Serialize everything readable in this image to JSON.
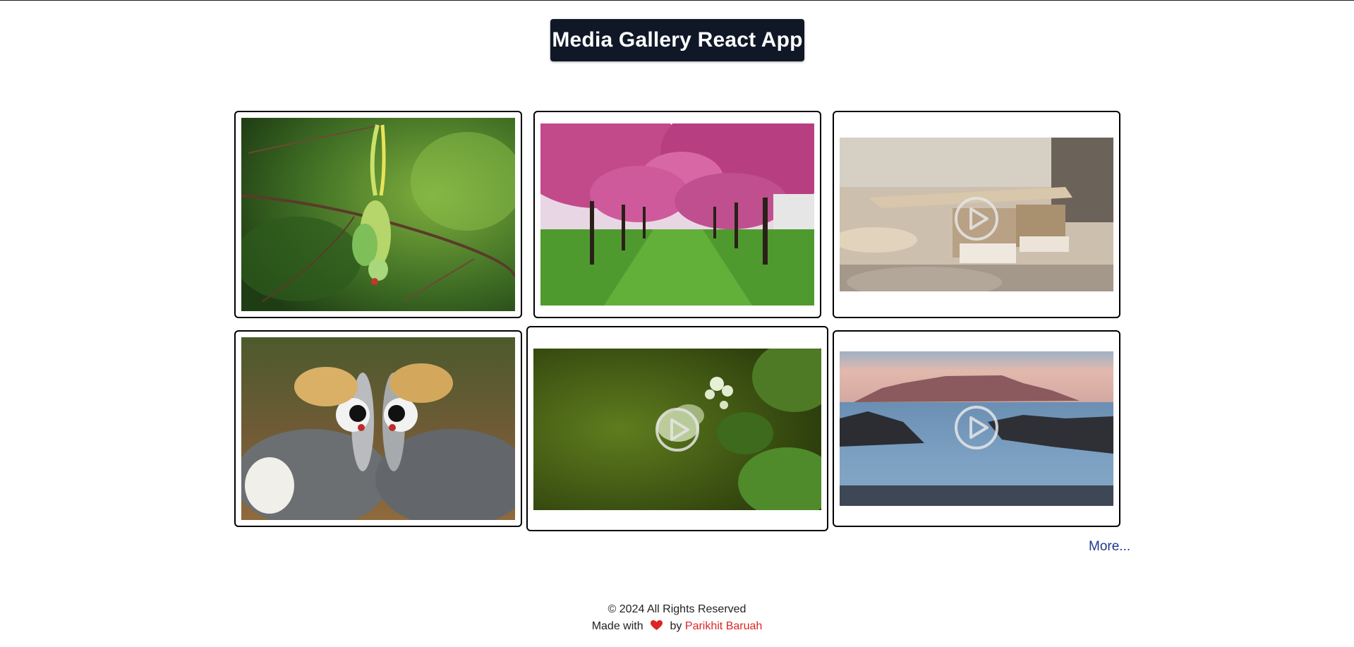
{
  "header": {
    "title": "Media Gallery React App"
  },
  "gallery": {
    "items": [
      {
        "type": "image",
        "subject": "parrot-on-branch"
      },
      {
        "type": "image",
        "subject": "cherry-blossom-avenue"
      },
      {
        "type": "video",
        "subject": "cafe-tables-and-chairs",
        "icon": "play-icon"
      },
      {
        "type": "image",
        "subject": "crowned-cranes"
      },
      {
        "type": "video",
        "subject": "butterfly-on-flowers",
        "icon": "play-icon"
      },
      {
        "type": "video",
        "subject": "table-mountain-coast",
        "icon": "play-icon"
      }
    ],
    "more_label": "More..."
  },
  "footer": {
    "copyright": "© 2024 All Rights Reserved",
    "made_with": "Made with",
    "heart_icon": "heart-icon",
    "by": "by",
    "author": "Parikhit Baruah",
    "author_color": "#dc2626"
  }
}
